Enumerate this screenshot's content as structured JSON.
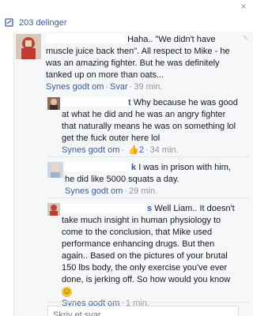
{
  "header": {
    "shares_text": "203 delinger",
    "close_label": "×"
  },
  "comments": [
    {
      "text": "Haha.. \"We didn't have muscle juice back then\". All respect to Mike - he was an amazing fighter. But he was definitely tanked up on more than oats...",
      "like": "Synes godt om",
      "reply": "Svar",
      "time": "39 min."
    },
    {
      "name_fragment": "t",
      "text": "Why because he was good at what he did and he was an angry fighter that naturally means he was on something lol get the fuck outer here lol",
      "like": "Synes godt om",
      "likes_count": "2",
      "time": "34 min."
    },
    {
      "name_fragment": "k",
      "text": "I was in prison with him, he did like 5000 squats a day.",
      "like": "Synes godt om",
      "time": "29 min."
    },
    {
      "name_fragment": "s",
      "text": "Well Liam.. It doesn't take much insight in human physiology to come to the conclusion, that Mike used performance enhancing drugs. But then again.. Based on the pictures of your brutal 150 lbs body, the only exercise you've ever done, is jerking off. So how would you know",
      "emoji": "☺",
      "like": "Synes godt om",
      "time": "1 min."
    }
  ],
  "reply_input": {
    "placeholder": "Skriv et svar..."
  }
}
